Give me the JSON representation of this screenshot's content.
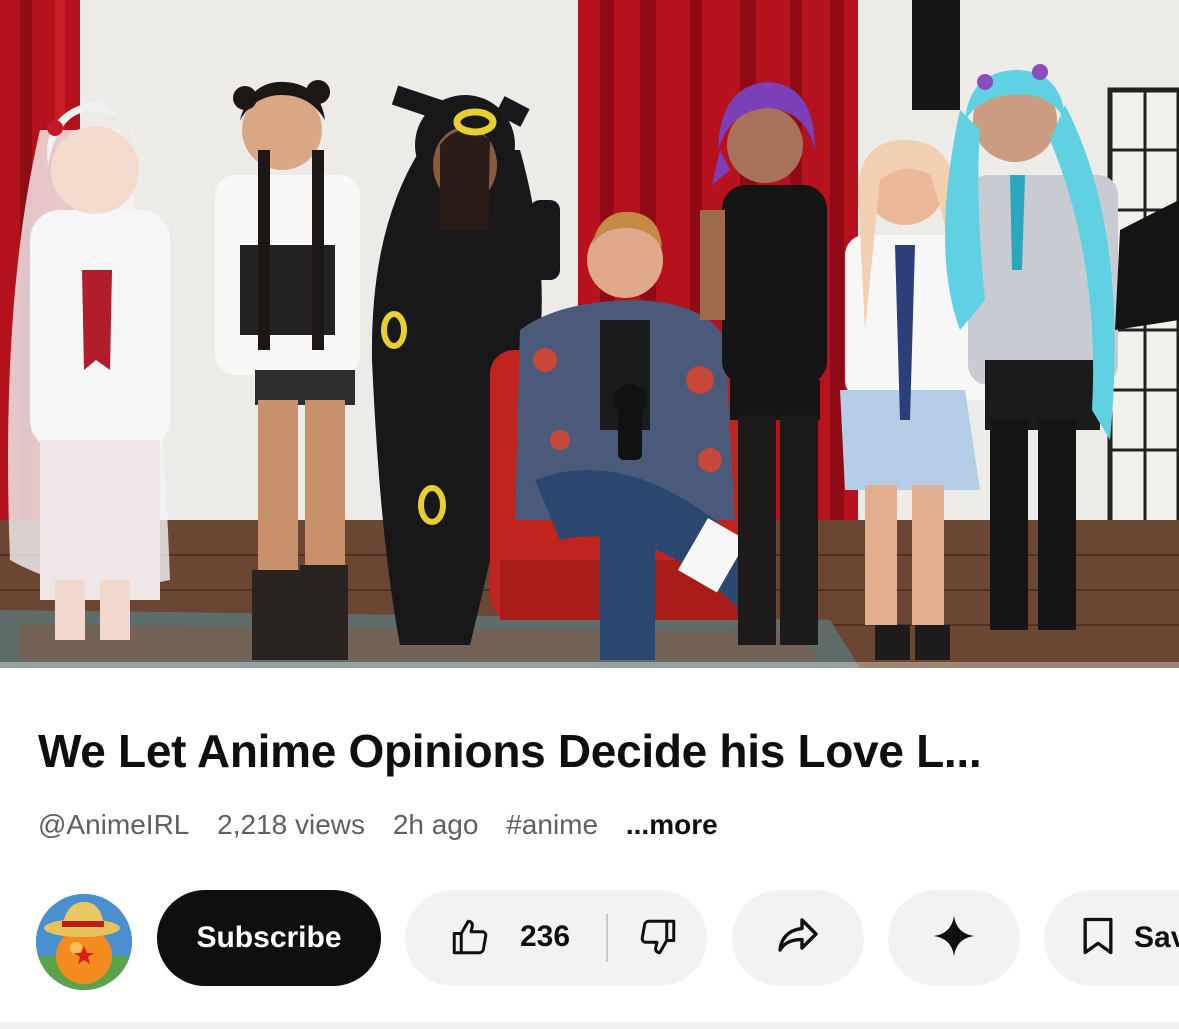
{
  "video": {
    "progress_fraction": 0.0,
    "accent_color": "#ff0000"
  },
  "title": "We Let Anime Opinions Decide his Love L...",
  "meta": {
    "channel": "@AnimeIRL",
    "views": "2,218 views",
    "age": "2h ago",
    "hashtag": "#anime",
    "more_label": "...more"
  },
  "actions": {
    "subscribe_label": "Subscribe",
    "like_count": "236",
    "save_label": "Sav"
  },
  "icons": {
    "like": "thumb-up-icon",
    "dislike": "thumb-down-icon",
    "share": "share-arrow-icon",
    "remix": "sparkle-icon",
    "save": "bookmark-icon"
  }
}
